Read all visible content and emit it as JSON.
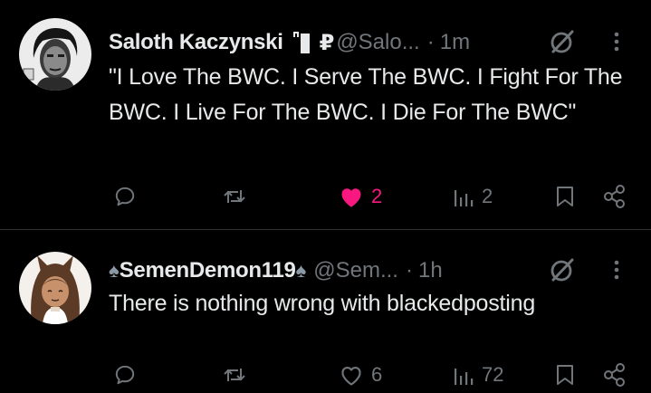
{
  "posts": [
    {
      "display_name": "Saloth Kaczynski",
      "badge_icon": "flag-icon",
      "currency_symbol": "₽",
      "handle": "@Salo...",
      "separator": "·",
      "time": "1m",
      "text": "\"I Love The BWC. I Serve The BWC. I Fight For The BWC. I Live For The BWC. I Die For The BWC\"",
      "actions": {
        "reply_count": "",
        "repost_count": "",
        "like_count": "2",
        "liked": true,
        "view_count": "2"
      }
    },
    {
      "name_prefix": "♠",
      "display_name": "SemenDemon119",
      "name_suffix": "♠",
      "handle": "@Sem...",
      "separator": "·",
      "time": "1h",
      "text": "There is nothing wrong with blackedposting",
      "actions": {
        "reply_count": "",
        "repost_count": "",
        "like_count": "6",
        "liked": false,
        "view_count": "72"
      }
    }
  ],
  "colors": {
    "background": "#000000",
    "text_primary": "#e7e9ea",
    "text_secondary": "#71767b",
    "like_active": "#f91880",
    "divider": "#2f3336"
  }
}
